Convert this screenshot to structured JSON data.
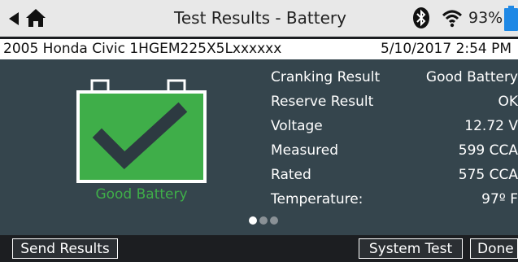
{
  "header": {
    "title": "Test Results - Battery",
    "battery_percent": "93%",
    "icons": [
      "back-arrow-icon",
      "home-icon",
      "bluetooth-icon",
      "wifi-icon",
      "battery-icon"
    ]
  },
  "info": {
    "vehicle": "2005 Honda Civic 1HGEM225X5Lxxxxxx",
    "datetime": "5/10/2017  2:54 PM"
  },
  "status": {
    "label": "Good Battery",
    "color": "#3fae49"
  },
  "results": [
    {
      "label": "Cranking Result",
      "value": "Good Battery"
    },
    {
      "label": "Reserve Result",
      "value": "OK"
    },
    {
      "label": "Voltage",
      "value": "12.72 V"
    },
    {
      "label": "Measured",
      "value": "599 CCA"
    },
    {
      "label": "Rated",
      "value": "575 CCA"
    },
    {
      "label": "Temperature:",
      "value": "97º F"
    }
  ],
  "pager": {
    "pages": 3,
    "current": 1
  },
  "footer": {
    "send_results": "Send Results",
    "system_test": "System Test",
    "done": "Done"
  },
  "colors": {
    "background": "#35454d",
    "accent_green": "#3fae49",
    "battery_icon_blue": "#1e88e5"
  }
}
